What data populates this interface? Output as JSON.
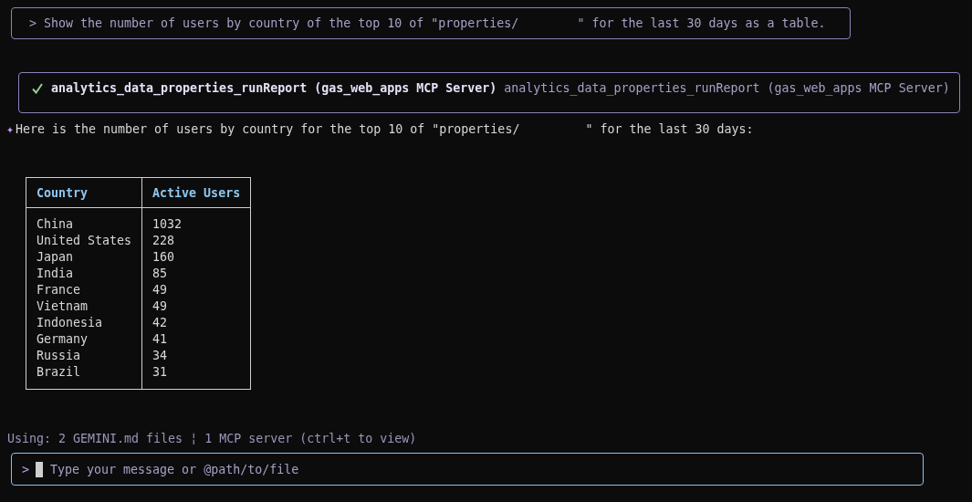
{
  "user_prompt": {
    "prefix": ">",
    "text": "Show the number of users by country of the top 10 of \"properties/        \" for the last 30 days as a table."
  },
  "tool_call": {
    "succeeded": true,
    "name": "analytics_data_properties_runReport (gas_web_apps MCP Server)",
    "description": "analytics_data_properties_runReport (gas_web_apps MCP Server)"
  },
  "response": {
    "marker": "✦",
    "text": "Here is the number of users by country for the top 10 of \"properties/         \" for the last 30 days:"
  },
  "table": {
    "columns": [
      "Country",
      "Active Users"
    ],
    "rows": [
      [
        "China",
        "1032"
      ],
      [
        "United States",
        "228"
      ],
      [
        "Japan",
        "160"
      ],
      [
        "India",
        "85"
      ],
      [
        "France",
        "49"
      ],
      [
        "Vietnam",
        "49"
      ],
      [
        "Indonesia",
        "42"
      ],
      [
        "Germany",
        "41"
      ],
      [
        "Russia",
        "34"
      ],
      [
        "Brazil",
        "31"
      ]
    ]
  },
  "context_status": "Using: 2 GEMINI.md files ¦ 1 MCP server (ctrl+t to view)",
  "input": {
    "prefix": ">",
    "placeholder": "Type your message or @path/to/file"
  }
}
